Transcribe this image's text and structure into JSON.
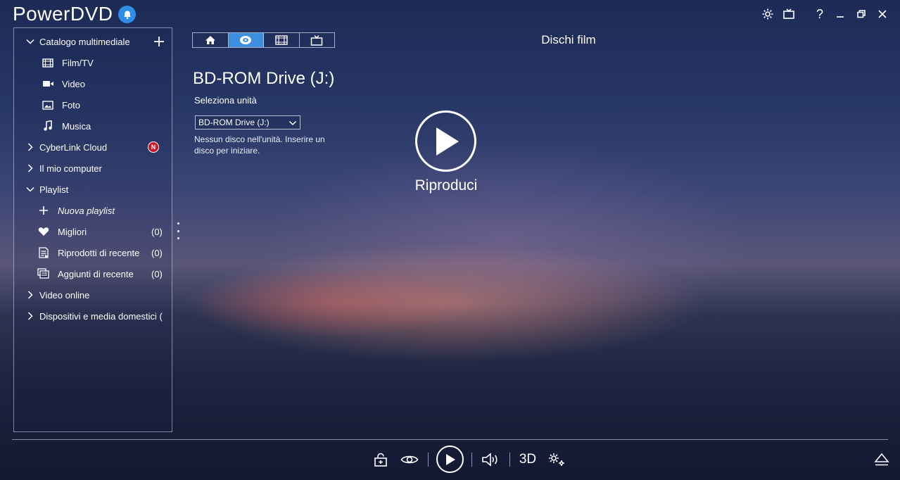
{
  "app": {
    "title": "PowerDVD"
  },
  "sidebar": {
    "items": [
      {
        "label": "Catalogo multimediale"
      },
      {
        "label": "Film/TV"
      },
      {
        "label": "Video"
      },
      {
        "label": "Foto"
      },
      {
        "label": "Musica"
      },
      {
        "label": "CyberLink Cloud",
        "badge": "N"
      },
      {
        "label": "Il mio computer"
      },
      {
        "label": "Playlist"
      },
      {
        "label": "Nuova playlist"
      },
      {
        "label": "Migliori",
        "count": "(0)"
      },
      {
        "label": "Riprodotti di recente",
        "count": "(0)"
      },
      {
        "label": "Aggiunti di recente",
        "count": "(0)"
      },
      {
        "label": "Video online"
      },
      {
        "label": "Dispositivi e media domestici ("
      }
    ]
  },
  "main": {
    "section_title": "Dischi film",
    "drive_title": "BD-ROM Drive (J:)",
    "select_label": "Seleziona unità",
    "selected_drive": "BD-ROM Drive (J:)",
    "message": "Nessun disco nell'unità. Inserire un disco per iniziare.",
    "play_label": "Riproduci"
  },
  "controls": {
    "three_d": "3D"
  },
  "colors": {
    "accent": "#3e8ee0",
    "bell": "#2f8fe8",
    "badge": "#c8192b"
  }
}
